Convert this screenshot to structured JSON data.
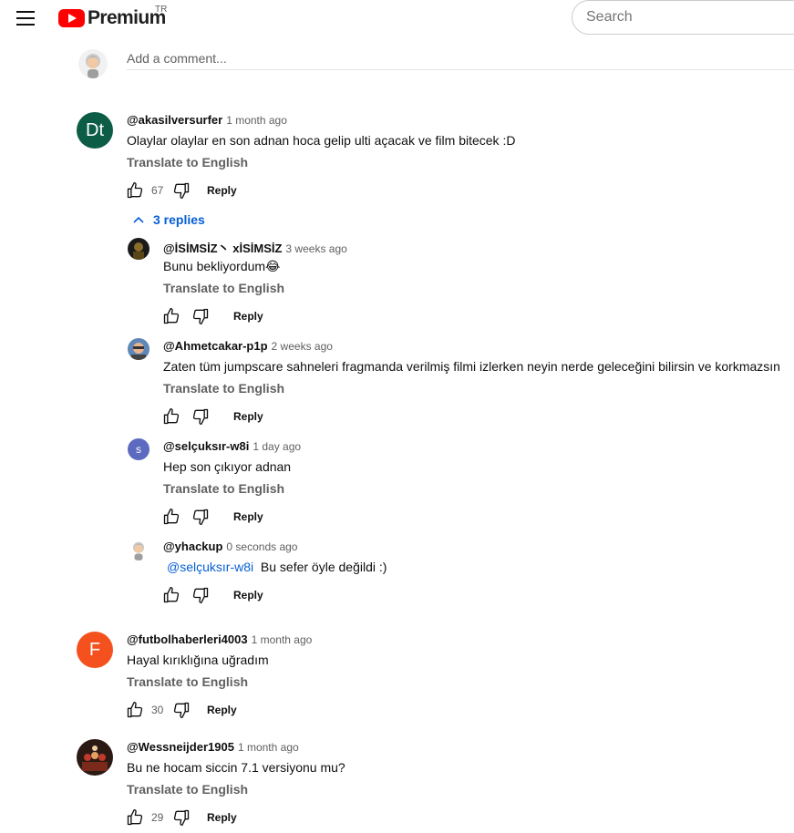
{
  "header": {
    "logo_text": "Premium",
    "region": "TR",
    "search_placeholder": "Search"
  },
  "add_comment_placeholder": "Add a comment...",
  "colors": {
    "accent_blue": "#065fd4",
    "brand_red": "#ff0000"
  },
  "comments": [
    {
      "author": "@akasilversurfer",
      "time": "1 month ago",
      "text": "Olaylar olaylar en son adnan hoca gelip ulti açacak ve film bitecek :D",
      "translate": "Translate to English",
      "likes": "67",
      "reply": "Reply",
      "avatar_letters": "Dt",
      "avatar_color": "#0d5c46",
      "replies_toggle": "3 replies",
      "replies": [
        {
          "author": "@İSİMSİZ丶 xİSİMSİZ",
          "time": "3 weeks ago",
          "text": "Bunu bekliyordum😂",
          "translate": "Translate to English",
          "reply": "Reply"
        },
        {
          "author": "@Ahmetcakar-p1p",
          "time": "2 weeks ago",
          "text": "Zaten tüm jumpscare sahneleri fragmanda verilmiş filmi izlerken neyin nerde geleceğini bilirsin ve korkmazsın",
          "translate": "Translate to English",
          "reply": "Reply"
        },
        {
          "author": "@selçuksır-w8i",
          "time": "1 day ago",
          "text": "Hep son çıkıyor adnan",
          "translate": "Translate to English",
          "reply": "Reply",
          "avatar_letters": "s",
          "avatar_color": "#5c6bc0"
        },
        {
          "author": "@yhackup",
          "time": "0 seconds ago",
          "mention": "@selçuksır-w8i",
          "text": "Bu sefer öyle değildi :)",
          "reply": "Reply"
        }
      ]
    },
    {
      "author": "@futbolhaberleri4003",
      "time": "1 month ago",
      "text": "Hayal kırıklığına uğradım",
      "translate": "Translate to English",
      "likes": "30",
      "reply": "Reply",
      "avatar_letters": "F",
      "avatar_color": "#f4511e"
    },
    {
      "author": "@Wessneijder1905",
      "time": "1 month ago",
      "text": "Bu ne hocam siccin 7.1 versiyonu mu?",
      "translate": "Translate to English",
      "likes": "29",
      "reply": "Reply"
    }
  ]
}
